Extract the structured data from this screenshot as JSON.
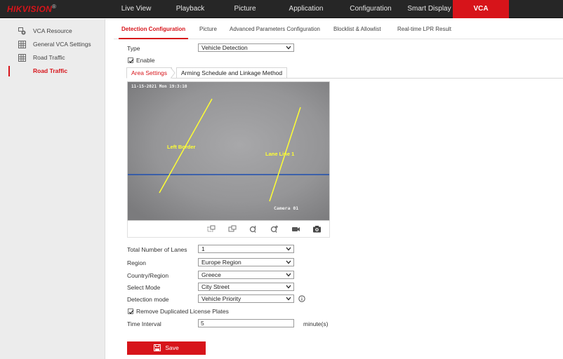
{
  "brand": {
    "logo_text": "HIKVISION",
    "logo_mark": "®"
  },
  "nav": {
    "items": [
      {
        "label": "Live View"
      },
      {
        "label": "Playback"
      },
      {
        "label": "Picture"
      },
      {
        "label": "Application"
      },
      {
        "label": "Configuration"
      },
      {
        "label": "Smart Display"
      },
      {
        "label": "VCA",
        "active": true
      }
    ]
  },
  "sidebar": {
    "items": [
      {
        "label": "VCA Resource",
        "icon": "vca-resource-icon"
      },
      {
        "label": "General VCA Settings",
        "icon": "grid-icon"
      },
      {
        "label": "Road Traffic",
        "icon": "grid-icon"
      },
      {
        "label": "Road Traffic",
        "active": true
      }
    ]
  },
  "subtabs": {
    "items": [
      {
        "label": "Detection Configuration",
        "active": true
      },
      {
        "label": "Picture"
      },
      {
        "label": "Advanced Parameters Configuration"
      },
      {
        "label": "Blocklist & Allowlist"
      },
      {
        "label": "Real-time LPR Result"
      }
    ]
  },
  "form": {
    "type_label": "Type",
    "type_value": "Vehicle Detection",
    "enable_label": "Enable",
    "enable_checked": true,
    "area_tab": "Area Settings",
    "schedule_tab": "Arming Schedule and Linkage Method",
    "lanes_label": "Total Number of Lanes",
    "lanes_value": "1",
    "region_label": "Region",
    "region_value": "Europe Region",
    "country_label": "Country/Region",
    "country_value": "Greece",
    "mode_label": "Select Mode",
    "mode_value": "City Street",
    "detection_label": "Detection mode",
    "detection_value": "Vehicle Priority",
    "remove_dup_label": "Remove Duplicated License Plates",
    "remove_dup_checked": true,
    "interval_label": "Time Interval",
    "interval_value": "5",
    "interval_unit": "minute(s)",
    "save_label": "Save"
  },
  "video": {
    "osd_time": "11-15-2021 Mon 19:3:10",
    "camera_name": "Camera 01",
    "left_border_label": "Left Border",
    "lane_line_label": "Lane Line 1"
  },
  "colors": {
    "accent": "#d7141a",
    "lane_line": "#ffff33",
    "horizon_line": "#1e4fb0"
  }
}
